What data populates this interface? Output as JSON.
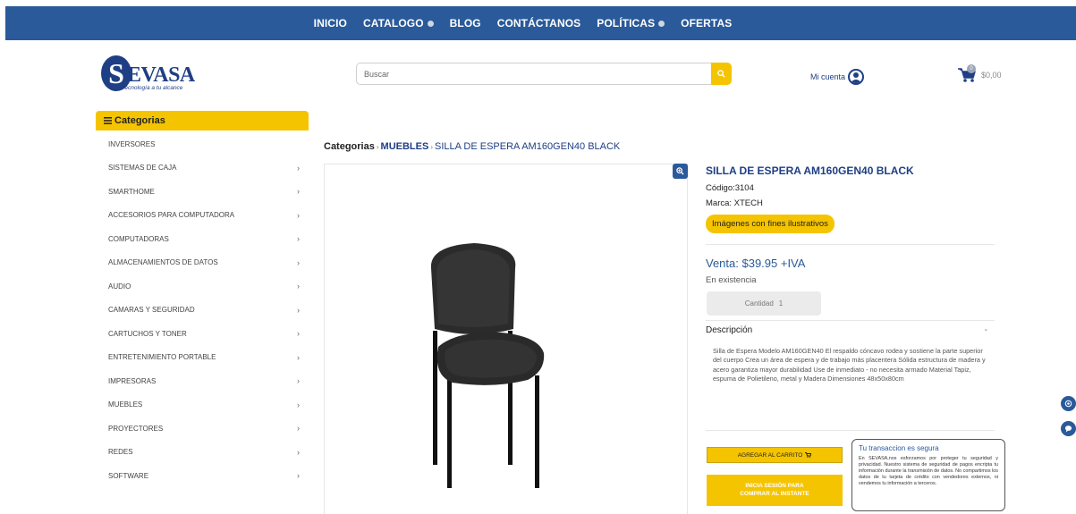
{
  "nav": {
    "items": [
      {
        "label": "INICIO",
        "dropdown": false
      },
      {
        "label": "CATALOGO",
        "dropdown": true
      },
      {
        "label": "BLOG",
        "dropdown": false
      },
      {
        "label": "CONTÁCTANOS",
        "dropdown": false
      },
      {
        "label": "POLÍTICAS",
        "dropdown": true
      },
      {
        "label": "OFERTAS",
        "dropdown": false
      }
    ]
  },
  "header": {
    "logo_letter": "S",
    "logo_text": "EVASA",
    "logo_tagline": "Tecnología a tu alcance",
    "search_placeholder": "Buscar",
    "account_label": "Mi cuenta",
    "cart_count": "0",
    "cart_total": "$0,00"
  },
  "sidebar": {
    "header_label": "Categorias",
    "items": [
      {
        "label": "INVERSORES",
        "has_children": false
      },
      {
        "label": "SISTEMAS DE CAJA",
        "has_children": true
      },
      {
        "label": "SMARTHOME",
        "has_children": true
      },
      {
        "label": "ACCESORIOS PARA COMPUTADORA",
        "has_children": true
      },
      {
        "label": "COMPUTADORAS",
        "has_children": true
      },
      {
        "label": "ALMACENAMIENTOS DE DATOS",
        "has_children": true
      },
      {
        "label": "AUDIO",
        "has_children": true
      },
      {
        "label": "CAMARAS Y SEGURIDAD",
        "has_children": true
      },
      {
        "label": "CARTUCHOS Y TONER",
        "has_children": true
      },
      {
        "label": "ENTRETENIMIENTO PORTABLE",
        "has_children": true
      },
      {
        "label": "IMPRESORAS",
        "has_children": true
      },
      {
        "label": "MUEBLES",
        "has_children": true
      },
      {
        "label": "PROYECTORES",
        "has_children": true
      },
      {
        "label": "REDES",
        "has_children": true
      },
      {
        "label": "SOFTWARE",
        "has_children": true
      }
    ]
  },
  "breadcrumb": {
    "root": "Categorias",
    "category": "MUEBLES",
    "current": "SILLA DE ESPERA AM160GEN40 BLACK"
  },
  "product": {
    "title": "SILLA DE ESPERA AM160GEN40 BLACK",
    "code": "Código:3104",
    "brand": "Marca: XTECH",
    "image_note": "Imágenes con fines ilustrativos",
    "price": "Venta: $39.95 +IVA",
    "stock": "En existencia",
    "qty_label": "Cantidad",
    "qty_value": "1",
    "description_header": "Descripción",
    "description_toggle": "-",
    "description": "Silla de Espera Modelo AM160GEN40 El respaldo cóncavo rodea y sostiene la parte superior del cuerpo Crea un área de espera y de trabajo más placentera Sólida estructura de madera y acero garantiza mayor durabilidad Use de inmediato - no necesita armado Material Tapiz, espuma de Polietileno, metal y Madera Dimensiones 48x50x80cm",
    "add_to_cart": "AGREGAR AL CARRITO",
    "buy_now_line1": "INICIA SESIÓN PARA",
    "buy_now_line2": "COMPRAR AL INSTANTE"
  },
  "secure": {
    "title": "Tu transaccion es segura",
    "text": "En SEVASA,nos esforzamos por proteger tu seguridad y privacidad. Nuestro sistema de seguridad de pagos encripta tu información durante la transmisión de datos. No compartimos los datos de tu tarjeta de crédito con vendedores externos, ni vendemos tu información a terceros."
  },
  "colors": {
    "brand_blue": "#2a5a9a",
    "accent_yellow": "#f5c400"
  }
}
